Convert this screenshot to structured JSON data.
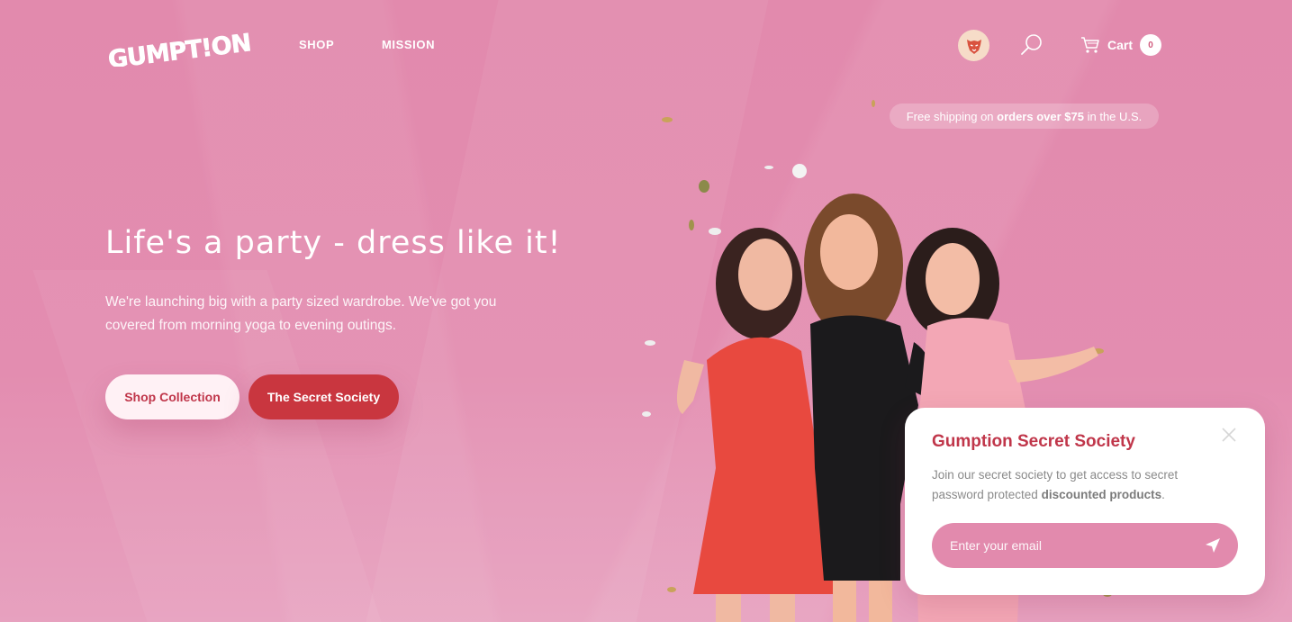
{
  "header": {
    "logo_text": "GUMPT!ON",
    "nav": [
      {
        "label": "SHOP"
      },
      {
        "label": "MISSION"
      }
    ],
    "cart": {
      "label": "Cart",
      "count": "0"
    }
  },
  "shipping": {
    "prefix": "Free shipping on ",
    "bold": "orders over $75",
    "suffix": " in the U.S."
  },
  "hero": {
    "title": "Life's a party - dress like it!",
    "subtitle": "We're launching big with a party sized wardrobe. We've got you covered from morning yoga to evening outings.",
    "primary_button": "Shop Collection",
    "secondary_button": "The Secret Society"
  },
  "popup": {
    "title": "Gumption Secret Society",
    "desc_prefix": "Join our secret society to get access to secret password protected ",
    "desc_bold": "discounted products",
    "desc_suffix": ".",
    "email_placeholder": "Enter your email"
  },
  "colors": {
    "background": "#e28aad",
    "accent_red": "#c9363f",
    "title_red": "#c0364a"
  },
  "icons": {
    "avatar": "tiger-face-icon",
    "search": "search-icon",
    "cart": "cart-icon",
    "close": "close-icon",
    "send": "paper-plane-icon"
  }
}
